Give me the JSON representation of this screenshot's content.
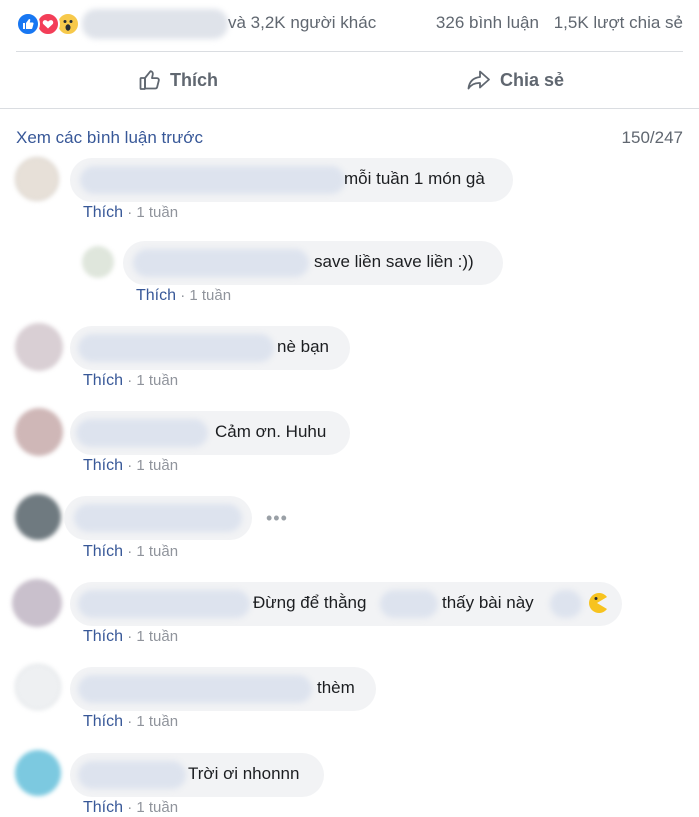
{
  "stats": {
    "others_text": "và 3,2K người khác",
    "comments_text": "326 bình luận",
    "shares_text": "1,5K lượt chia sẻ",
    "reaction_icons": [
      "like-icon",
      "love-icon",
      "wow-icon"
    ]
  },
  "actions": {
    "like_label": "Thích",
    "share_label": "Chia sẻ"
  },
  "comments_header": {
    "view_previous": "Xem các bình luận trước",
    "count": "150/247"
  },
  "comments": [
    {
      "text": "mỗi tuần 1 món gà",
      "like": "Thích",
      "time": "· 1 tuần"
    },
    {
      "text": "save liền save liền :))",
      "like": "Thích",
      "time": "· 1 tuần"
    },
    {
      "text": "nè bạn",
      "like": "Thích",
      "time": "· 1 tuần"
    },
    {
      "text": "Cảm ơn. Huhu",
      "like": "Thích",
      "time": "· 1 tuần"
    },
    {
      "text": "",
      "like": "Thích",
      "time": "· 1 tuần",
      "more": "•••"
    },
    {
      "text_a": "Đừng để thằng",
      "text_b": "thấy bài này",
      "like": "Thích",
      "time": "· 1 tuần"
    },
    {
      "text": "thèm",
      "like": "Thích",
      "time": "· 1 tuần"
    },
    {
      "text": "Trời ơi nhonnn",
      "like": "Thích",
      "time": "· 1 tuần"
    }
  ],
  "colors": {
    "link": "#385898",
    "muted": "#606770",
    "bubble": "#f2f3f5",
    "like_blue": "#1877f2",
    "love_red": "#f33e58",
    "wow_yellow": "#f7c94b"
  }
}
